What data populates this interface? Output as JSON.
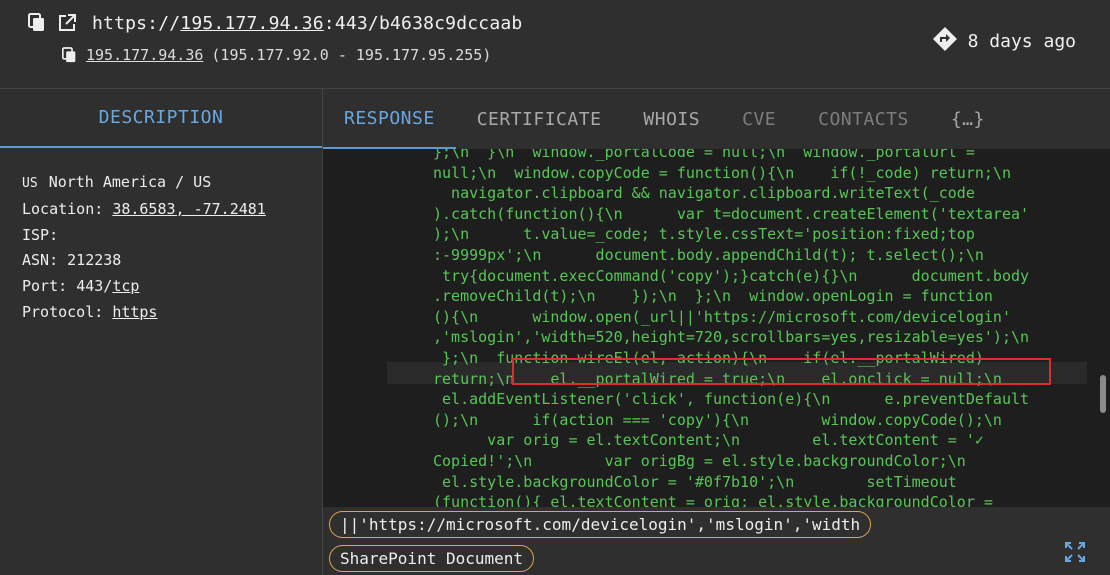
{
  "header": {
    "url_prefix": "https://",
    "url_host": "195.177.94.36",
    "url_suffix": ":443/b4638c9dccaab",
    "ip": "195.177.94.36",
    "ip_range": "(195.177.92.0 - 195.177.95.255)",
    "time_ago": "8 days ago",
    "icons": [
      "copy-icon",
      "external-link-icon",
      "copy-icon",
      "directions-icon"
    ]
  },
  "left": {
    "tab_label": "DESCRIPTION",
    "flag": "US",
    "region": "North America / US",
    "location_label": "Location:",
    "location_value": "38.6583, -77.2481",
    "isp_label": "ISP:",
    "isp_value": "",
    "asn_label": "ASN:",
    "asn_value": "212238",
    "port_label": "Port:",
    "port_number": "443/",
    "port_proto": "tcp",
    "protocol_label": "Protocol:",
    "protocol_value": "https"
  },
  "tabs": [
    {
      "label": "RESPONSE"
    },
    {
      "label": "CERTIFICATE"
    },
    {
      "label": "WHOIS"
    },
    {
      "label": "CVE"
    },
    {
      "label": "CONTACTS"
    },
    {
      "label": "{…}"
    }
  ],
  "code": {
    "text": "};\\n  }\\n  window._portalCode = null;\\n  window._portalUrl =\nnull;\\n  window.copyCode = function(){\\n    if(!_code) return;\\n\n  navigator.clipboard && navigator.clipboard.writeText(_code\n).catch(function(){\\n      var t=document.createElement('textarea'\n);\\n      t.value=_code; t.style.cssText='position:fixed;top\n:-9999px';\\n      document.body.appendChild(t); t.select();\\n\n try{document.execCommand('copy');}catch(e){}\\n      document.body\n.removeChild(t);\\n    });\\n  };\\n  window.openLogin = function\n(){\\n      window.open(_url||'https://microsoft.com/devicelogin'\n,'mslogin','width=520,height=720,scrollbars=yes,resizable=yes');\\n\n };\\n  function wireEl(el, action){\\n    if(el.__portalWired)\nreturn;\\n    el.__portalWired = true;\\n    el.onclick = null;\\n\n el.addEventListener('click', function(e){\\n      e.preventDefault\n();\\n      if(action === 'copy'){\\n        window.copyCode();\\n\n      var orig = el.textContent;\\n        el.textContent = '✓\nCopied!';\\n        var origBg = el.style.backgroundColor;\\n\n el.style.backgroundColor = '#0f7b10';\\n        setTimeout\n(function(){ el.textContent = orig; el.style.backgroundColor ="
  },
  "chips": [
    {
      "label": "||'https://microsoft.com/devicelogin','mslogin','width"
    },
    {
      "label": "SharePoint Document"
    }
  ],
  "colors": {
    "accent": "#5b9bd5",
    "code_green": "#57c657",
    "highlight_red": "#d9302c",
    "chip_border": "#e0a84a"
  }
}
